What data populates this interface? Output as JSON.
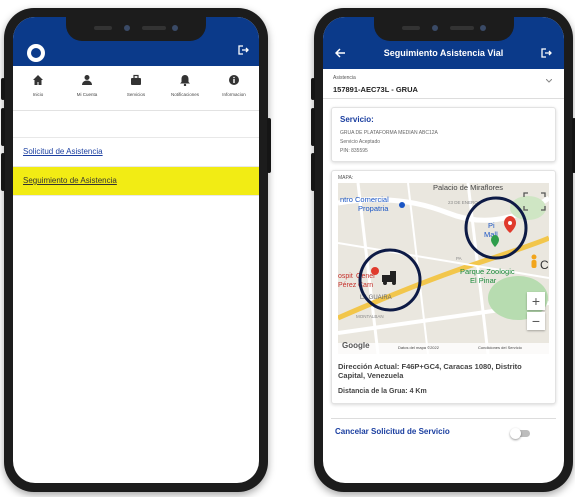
{
  "left": {
    "nav": [
      {
        "label": "Inicio",
        "icon": "home-icon"
      },
      {
        "label": "Mi Cuenta",
        "icon": "user-icon"
      },
      {
        "label": "Servicios",
        "icon": "briefcase-icon"
      },
      {
        "label": "Notificaciones",
        "icon": "bell-icon"
      },
      {
        "label": "Informacion",
        "icon": "info-icon"
      }
    ],
    "menu": [
      {
        "label": "Solicitud de Asistencia",
        "highlighted": false
      },
      {
        "label": "Seguimiento de Asistencia",
        "highlighted": true
      }
    ]
  },
  "right": {
    "title": "Seguimiento Asistencia Vial",
    "assistance_label": "Asistencia",
    "assistance_value": "157891-AEC73L - GRUA",
    "service_title": "Servicio:",
    "service_lines": [
      "GRUA DE PLATAFORMA MEDIAN ABC12A",
      "Servicio Aceptado",
      "PIN: 835595"
    ],
    "map_label": "MAPA:",
    "map_places": {
      "palacio": "Palacio de Miraflores",
      "centro1": "ntro Comercial",
      "centro2": "Propatria",
      "parque1": "Parque Zoologic",
      "parque2": "El Pinar",
      "hospital1": "ospit",
      "hospital2": "Gener",
      "hospital3": "Pérez",
      "hospital4": "Carn",
      "laguaira": "LA GUAIRA",
      "montalban": "MONTALBAN",
      "enero": "23 DE ENERO",
      "pi1": "Pi",
      "pi2": "Mall",
      "pa": "PA",
      "c": "C",
      "google": "Google",
      "attribution": "Datos del mapa ©2022",
      "terms": "Condiciones del Servicio"
    },
    "zoom_in": "+",
    "zoom_out": "−",
    "address": "Dirección Actual: F46P+GC4, Caracas 1080, Distrito Capital, Venezuela",
    "distance": "Distancia de la Grua: 4 Km",
    "cancel_label": "Cancelar Solicitud de Servicio",
    "cancel_toggle_on": false
  },
  "colors": {
    "header": "#0b3a8a",
    "highlight": "#f2ec14",
    "link": "#1a3ea0",
    "circle": "#0d1a45"
  }
}
